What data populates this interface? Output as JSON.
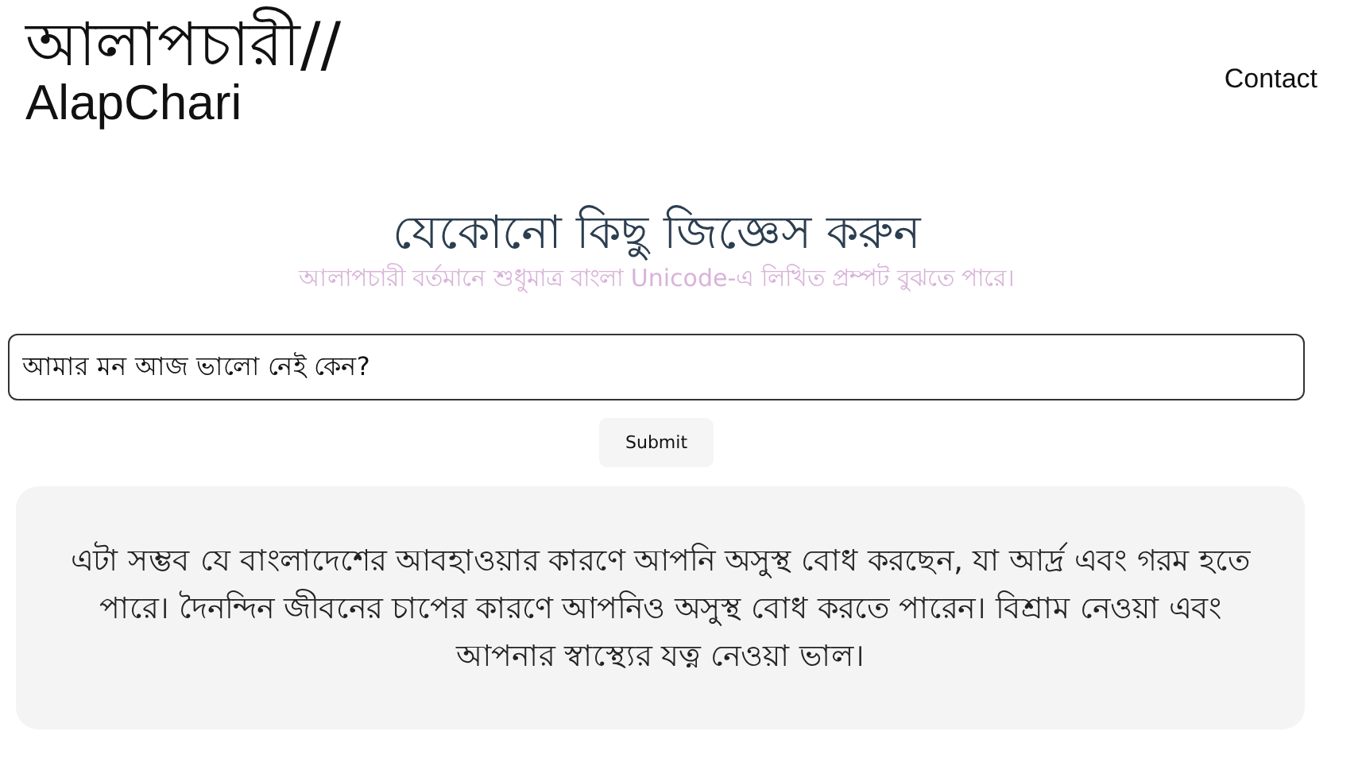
{
  "header": {
    "logo_bengali": "আলাপচারী//",
    "logo_latin": "AlapChari",
    "nav": [
      {
        "label": "Contact"
      }
    ]
  },
  "main": {
    "title": "যেকোনো কিছু জিজ্ঞেস করুন",
    "subtitle": "আলাপচারী বর্তমানে শুধুমাত্র বাংলা Unicode-এ লিখিত প্রম্পট বুঝতে পারে।",
    "question": {
      "value": "আমার মন আজ ভালো নেই কেন?"
    },
    "submit": "Submit",
    "answer": "এটা সম্ভব যে বাংলাদেশের আবহাওয়ার কারণে আপনি অসুস্থ বোধ করছেন, যা আর্দ্র এবং গরম হতে পারে। দৈনন্দিন জীবনের চাপের কারণে আপনিও অসুস্থ বোধ করতে পারেন। বিশ্রাম নেওয়া এবং আপনার স্বাস্থ্যের যত্ন নেওয়া ভাল।"
  }
}
